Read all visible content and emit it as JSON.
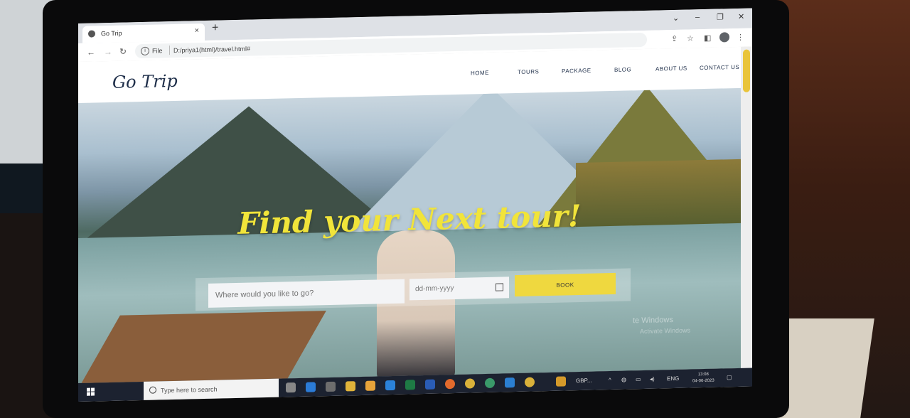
{
  "browser": {
    "tab_title": "Go Trip",
    "tab_close": "×",
    "new_tab": "+",
    "omnibox": {
      "scheme_label": "File",
      "url": "D:/priya1(html)/travel.html#"
    }
  },
  "site": {
    "logo": "Go Trip",
    "nav": [
      {
        "label": "HOME"
      },
      {
        "label": "TOURS"
      },
      {
        "label": "PACKAGE"
      },
      {
        "label": "BLOG"
      },
      {
        "label": "ABOUT US"
      },
      {
        "label": "CONTACT US"
      }
    ],
    "hero": {
      "title": "Find your Next tour!",
      "destination_placeholder": "Where would you like to go?",
      "date_placeholder": "dd-mm-yyyy",
      "book_label": "BOOK"
    },
    "watermark": {
      "line1": "te Windows",
      "line2": "Activate Windows"
    }
  },
  "taskbar": {
    "search_placeholder": "Type here to search",
    "app_label": "GBP...",
    "language": "ENG",
    "time": "13:08",
    "date": "04-06-2023"
  },
  "colors": {
    "accent_yellow": "#efd83f",
    "navy": "#1d2d48"
  }
}
